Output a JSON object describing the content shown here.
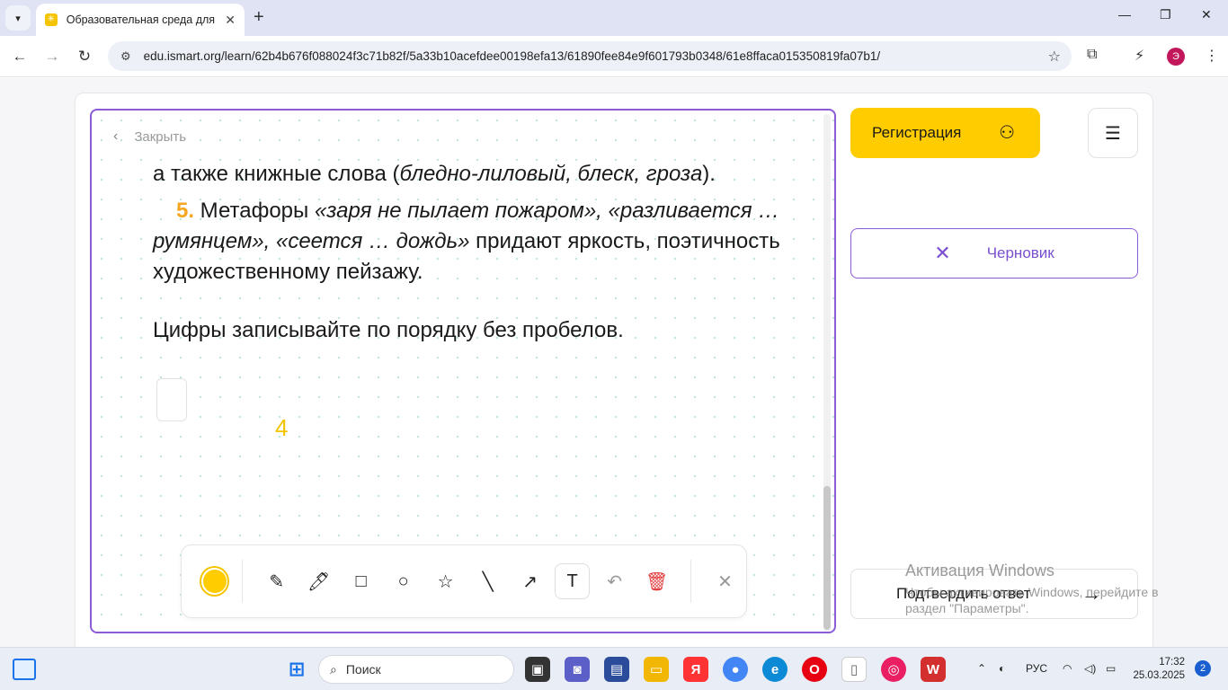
{
  "browser": {
    "tab_title": "Образовательная среда для са",
    "url": "edu.ismart.org/learn/62b4b676f088024f3c71b82f/5a33b10acefdee00198efa13/61890fee84e9f601793b0348/61e8ffaca015350819fa07b1/",
    "profile_initial": "Э"
  },
  "task": {
    "close_label": "Закрыть",
    "line1_normal": "а также книжные слова (",
    "line1_italic": "бледно-лиловый, блеск, гроза",
    "line1_end": ").",
    "item5_number": "5.",
    "item5_a": " Метафоры ",
    "item5_b": "«заря не пылает пожаром», «разливается … румянцем», «сеется … дождь»",
    "item5_c": " придают яркость, поэтичность художественному пейзажу.",
    "instruction": "Цифры записывайте по порядку без пробелов.",
    "drawn_text": "4"
  },
  "sidebar": {
    "register_label": "Регистрация",
    "draft_label": "Черновик",
    "confirm_label": "Подтвердить ответ"
  },
  "watermark": {
    "title": "Активация Windows",
    "subtitle": "Чтобы активировать Windows, перейдите в раздел \"Параметры\"."
  },
  "taskbar": {
    "search_placeholder": "Поиск",
    "language": "РУС",
    "time": "17:32",
    "date": "25.03.2025",
    "notifications": "2"
  },
  "colors": {
    "accent_yellow": "#ffcc00",
    "accent_purple": "#8c5cd6",
    "number_orange": "#f6a623"
  }
}
